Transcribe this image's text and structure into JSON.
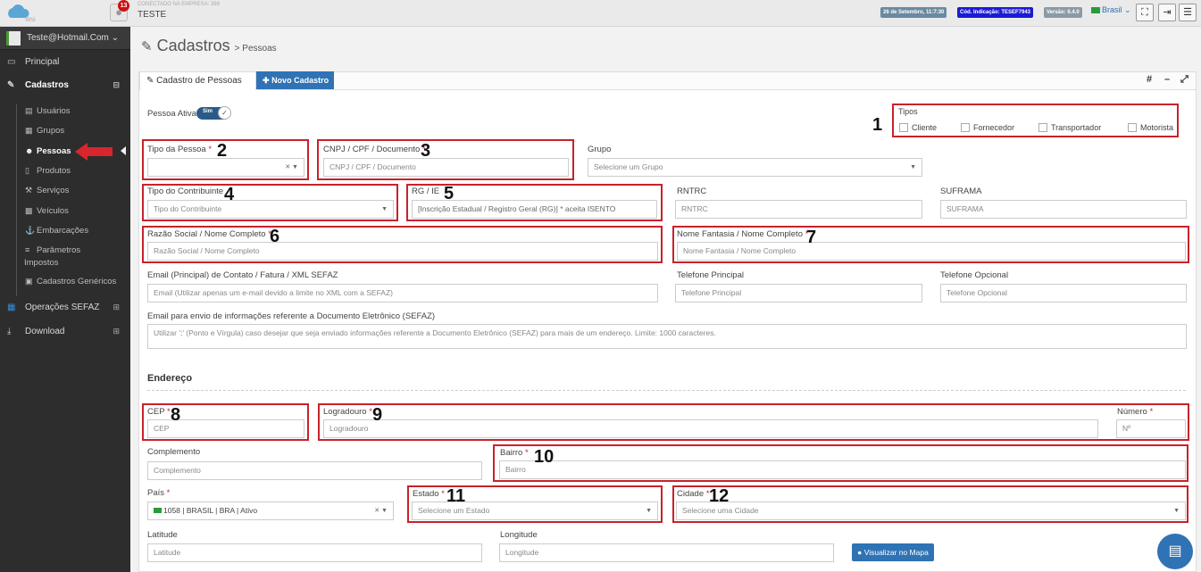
{
  "topbar": {
    "logo_text": "Wsi",
    "notif_count": "13",
    "connected_label": "CONECTADO NA EMPRESA: 398",
    "company": "TESTE",
    "date_tag": "26 de Setembro, 11:7:30",
    "code_tag": "Cód. Indicação: TESEF7943",
    "version_tag": "Versão: 6.4.0",
    "language": "Brasil",
    "tag_colors": {
      "date": "#6a8aa0",
      "code": "#1a1ad6",
      "version": "#8a9aa6"
    }
  },
  "sidebar": {
    "user": "Teste@Hotmail.Com",
    "menu": {
      "principal": "Principal",
      "cadastros": "Cadastros",
      "operacoes": "Operações SEFAZ",
      "download": "Download"
    },
    "sub": {
      "usuarios": "Usuários",
      "grupos": "Grupos",
      "pessoas": "Pessoas",
      "produtos": "Produtos",
      "servicos": "Serviços",
      "veiculos": "Veículos",
      "embarcacoes": "Embarcações",
      "parametros1": "Parâmetros",
      "parametros2": "Impostos",
      "genericos": "Cadastros Genéricos"
    }
  },
  "page": {
    "title": "Cadastros",
    "crumb": "> Pessoas"
  },
  "tabs": {
    "pessoas": "Cadastro de Pessoas",
    "novo": "Novo Cadastro"
  },
  "form": {
    "pessoa_ativa": "Pessoa Ativa",
    "toggle": "Sim",
    "tipos": "Tipos",
    "tipo_opts": {
      "cliente": "Cliente",
      "fornecedor": "Fornecedor",
      "transportador": "Transportador",
      "motorista": "Motorista"
    },
    "tipo_pessoa": "Tipo da Pessoa",
    "cnpj_label": "CNPJ / CPF / Documento",
    "cnpj_ph": "CNPJ / CPF / Documento",
    "grupo_label": "Grupo",
    "grupo_ph": "Selecione um Grupo",
    "contrib_label": "Tipo do Contribuinte",
    "contrib_ph": "Tipo do Contribuinte",
    "rg_label": "RG / IE",
    "rg_ph": "[Inscrição Estadual / Registro Geral (RG)] * aceita ISENTO",
    "rntrc_label": "RNTRC",
    "rntrc_ph": "RNTRC",
    "suframa_label": "SUFRAMA",
    "suframa_ph": "SUFRAMA",
    "razao_label": "Razão Social / Nome Completo",
    "razao_ph": "Razão Social / Nome Completo",
    "fantasia_label": "Nome Fantasia / Nome Completo",
    "fantasia_ph": "Nome Fantasia / Nome Completo",
    "email_label": "Email (Principal) de Contato / Fatura / XML SEFAZ",
    "email_ph": "Email (Utilizar apenas um e-mail devido a limite no XML com a SEFAZ)",
    "tel_label": "Telefone Principal",
    "tel_ph": "Telefone Principal",
    "telop_label": "Telefone Opcional",
    "telop_ph": "Telefone Opcional",
    "email2_label": "Email para envio de informações referente a Documento Eletrônico (SEFAZ)",
    "email2_ph": "Utilizar ';' (Ponto e Vírgula) caso desejar que seja enviado informações referente a Documento Eletrônico (SEFAZ) para mais de um endereço. Limite: 1000 caracteres.",
    "endereco": "Endereço",
    "cep_label": "CEP",
    "cep_ph": "CEP",
    "logradouro_label": "Logradouro",
    "logradouro_ph": "Logradouro",
    "numero_label": "Número",
    "numero_ph": "Nº",
    "complemento_label": "Complemento",
    "complemento_ph": "Complemento",
    "bairro_label": "Bairro",
    "bairro_ph": "Bairro",
    "pais_label": "País",
    "pais_value": "1058 | BRASIL | BRA | Ativo",
    "estado_label": "Estado",
    "estado_ph": "Selecione um Estado",
    "cidade_label": "Cidade",
    "cidade_ph": "Selecione uma Cidade",
    "lat_label": "Latitude",
    "lat_ph": "Latitude",
    "lon_label": "Longitude",
    "lon_ph": "Longitude",
    "mapa_btn": "Visualizar no Mapa",
    "req": "*"
  },
  "annotations": [
    "1",
    "2",
    "3",
    "4",
    "5",
    "6",
    "7",
    "8",
    "9",
    "10",
    "11",
    "12"
  ],
  "annotation_color": "#c8222a"
}
